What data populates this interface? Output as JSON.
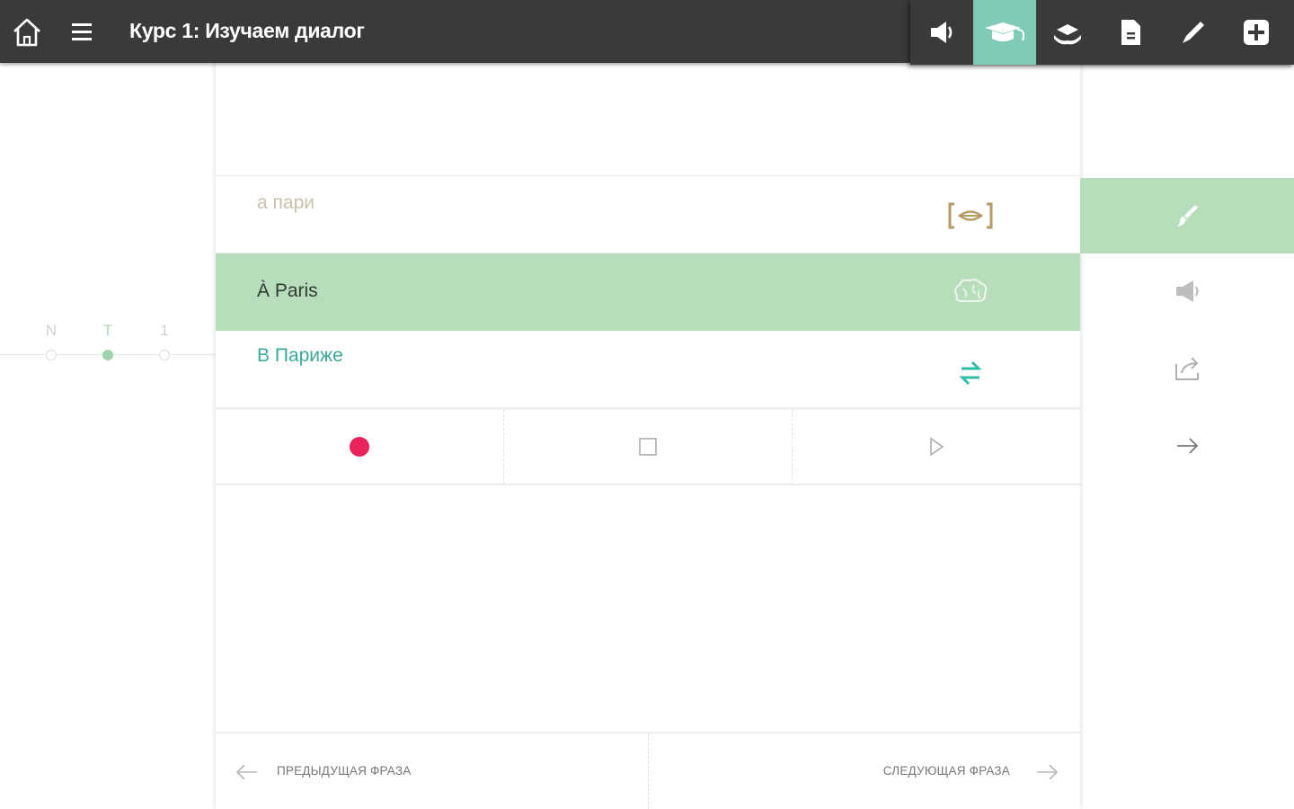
{
  "header": {
    "title": "Курс 1: Изучаем диалог",
    "icons": [
      "home-icon",
      "menu-icon"
    ]
  },
  "toolbar": {
    "items": [
      {
        "name": "speaker-icon",
        "active": false
      },
      {
        "name": "graduation-cap-icon",
        "active": true
      },
      {
        "name": "book-hand-icon",
        "active": false
      },
      {
        "name": "document-icon",
        "active": false
      },
      {
        "name": "pencil-icon",
        "active": false
      },
      {
        "name": "add-icon",
        "active": false
      }
    ],
    "active_color": "#7fcbb8"
  },
  "phrase": {
    "transcription": "а пари",
    "original": "À Paris",
    "translation": "В Париже"
  },
  "row_icons": [
    "lips-bracket-icon",
    "brain-icon",
    "swap-arrows-icon"
  ],
  "controls": [
    "record-icon",
    "stop-icon",
    "play-icon"
  ],
  "footer": {
    "prev_label": "ПРЕДЫДУЩАЯ ФРАЗА",
    "next_label": "СЛЕДУЮЩАЯ ФРАЗА"
  },
  "stepper": {
    "steps": [
      {
        "label": "N",
        "active": false
      },
      {
        "label": "T",
        "active": true
      },
      {
        "label": "1",
        "active": false
      }
    ]
  },
  "side_panel": {
    "items": [
      "brush-icon",
      "speaker-icon",
      "share-icon",
      "arrow-right-icon"
    ],
    "highlight_color": "#b7ddbb"
  },
  "colors": {
    "topbar": "#3a3a3a",
    "highlight_row": "#b7ddbb",
    "translation_text": "#3ba89a",
    "record": "#e8225a"
  }
}
